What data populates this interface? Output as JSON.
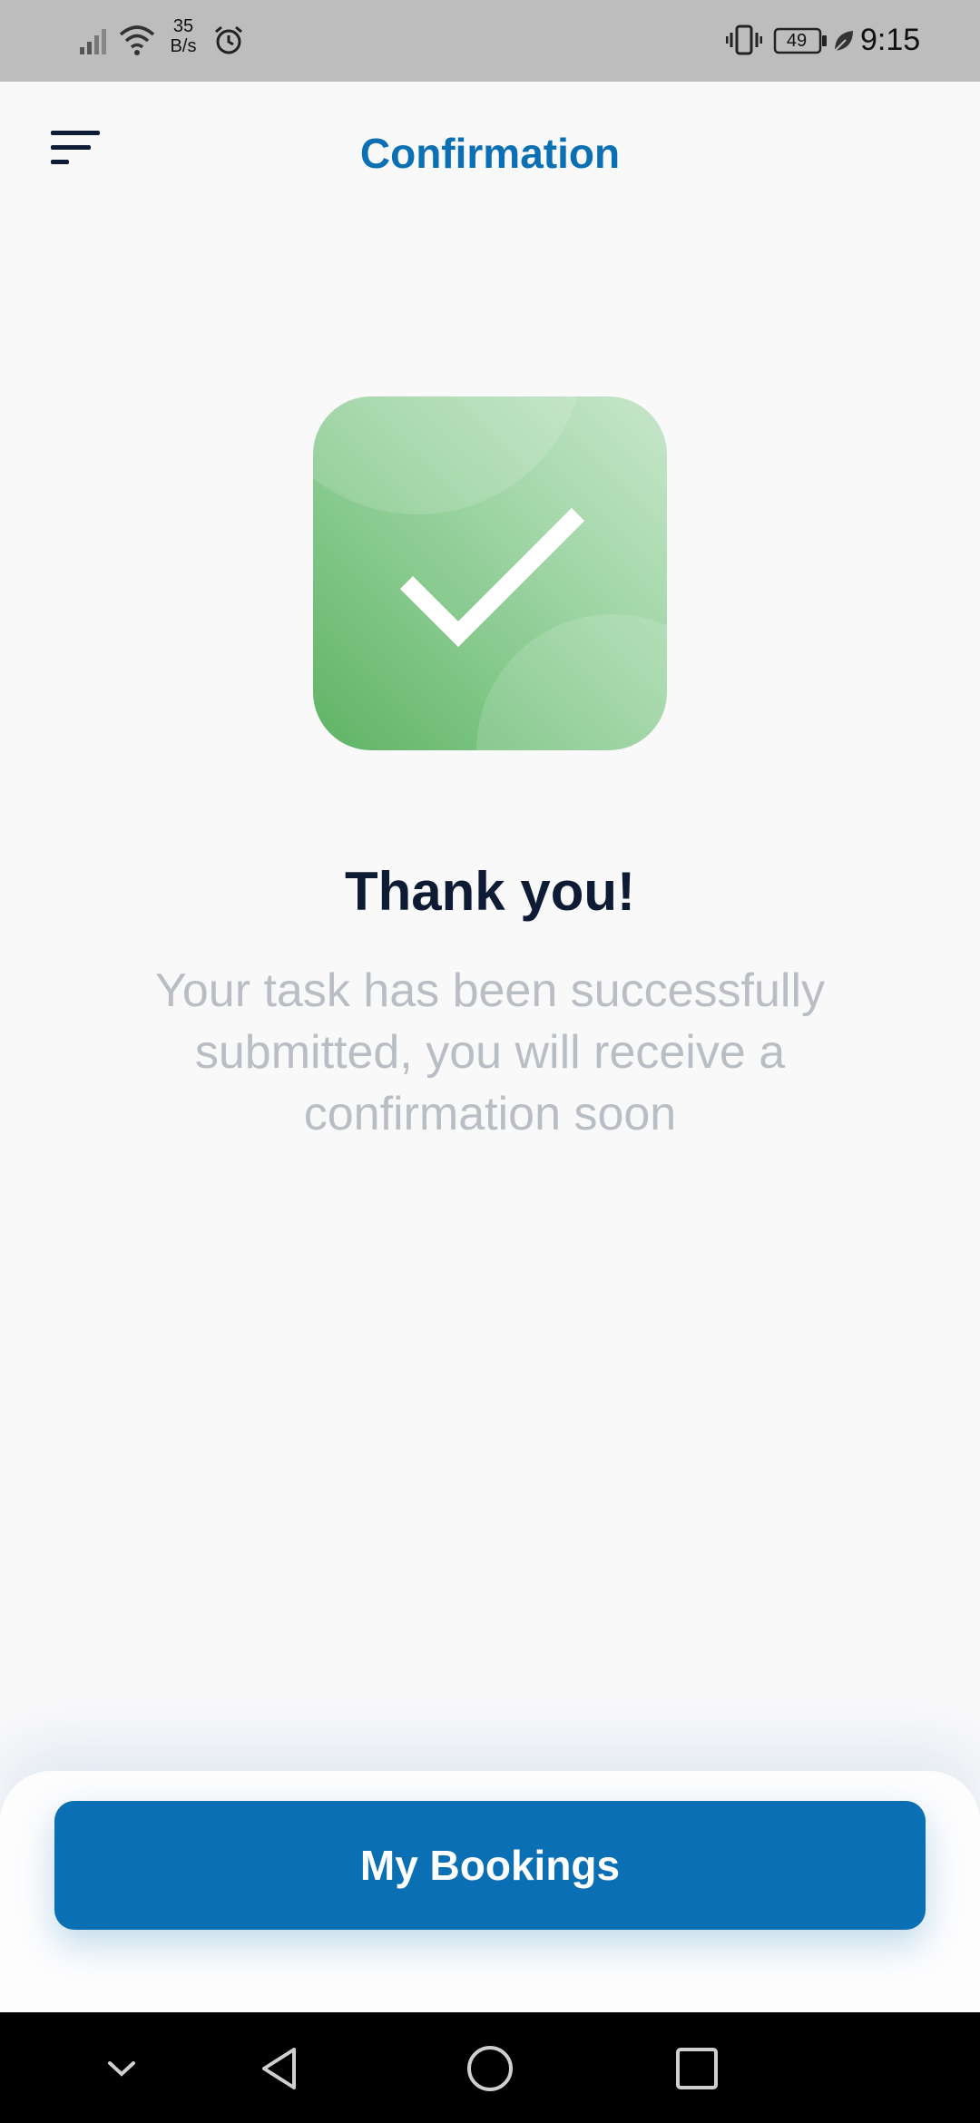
{
  "status_bar": {
    "net_rate_top": "35",
    "net_rate_bottom": "B/s",
    "battery": "49",
    "time": "9:15",
    "icons": [
      "signal-icon",
      "wifi-icon",
      "alarm-icon",
      "vibrate-icon",
      "battery-icon",
      "leaf-icon"
    ]
  },
  "header": {
    "title": "Confirmation",
    "menu_icon": "menu-icon"
  },
  "success": {
    "icon": "checkmark-icon",
    "title": "Thank you!",
    "message": "Your task has been successfully submitted, you will receive a confirmation soon"
  },
  "actions": {
    "primary_label": "My Bookings"
  },
  "nav": {
    "icons": [
      "chevron-down-icon",
      "back-icon",
      "home-icon",
      "recents-icon"
    ]
  },
  "colors": {
    "accent": "#0b70b3",
    "title_dark": "#0e1b35",
    "message_gray": "#b9bdc4",
    "success_green": "#78c27f"
  }
}
